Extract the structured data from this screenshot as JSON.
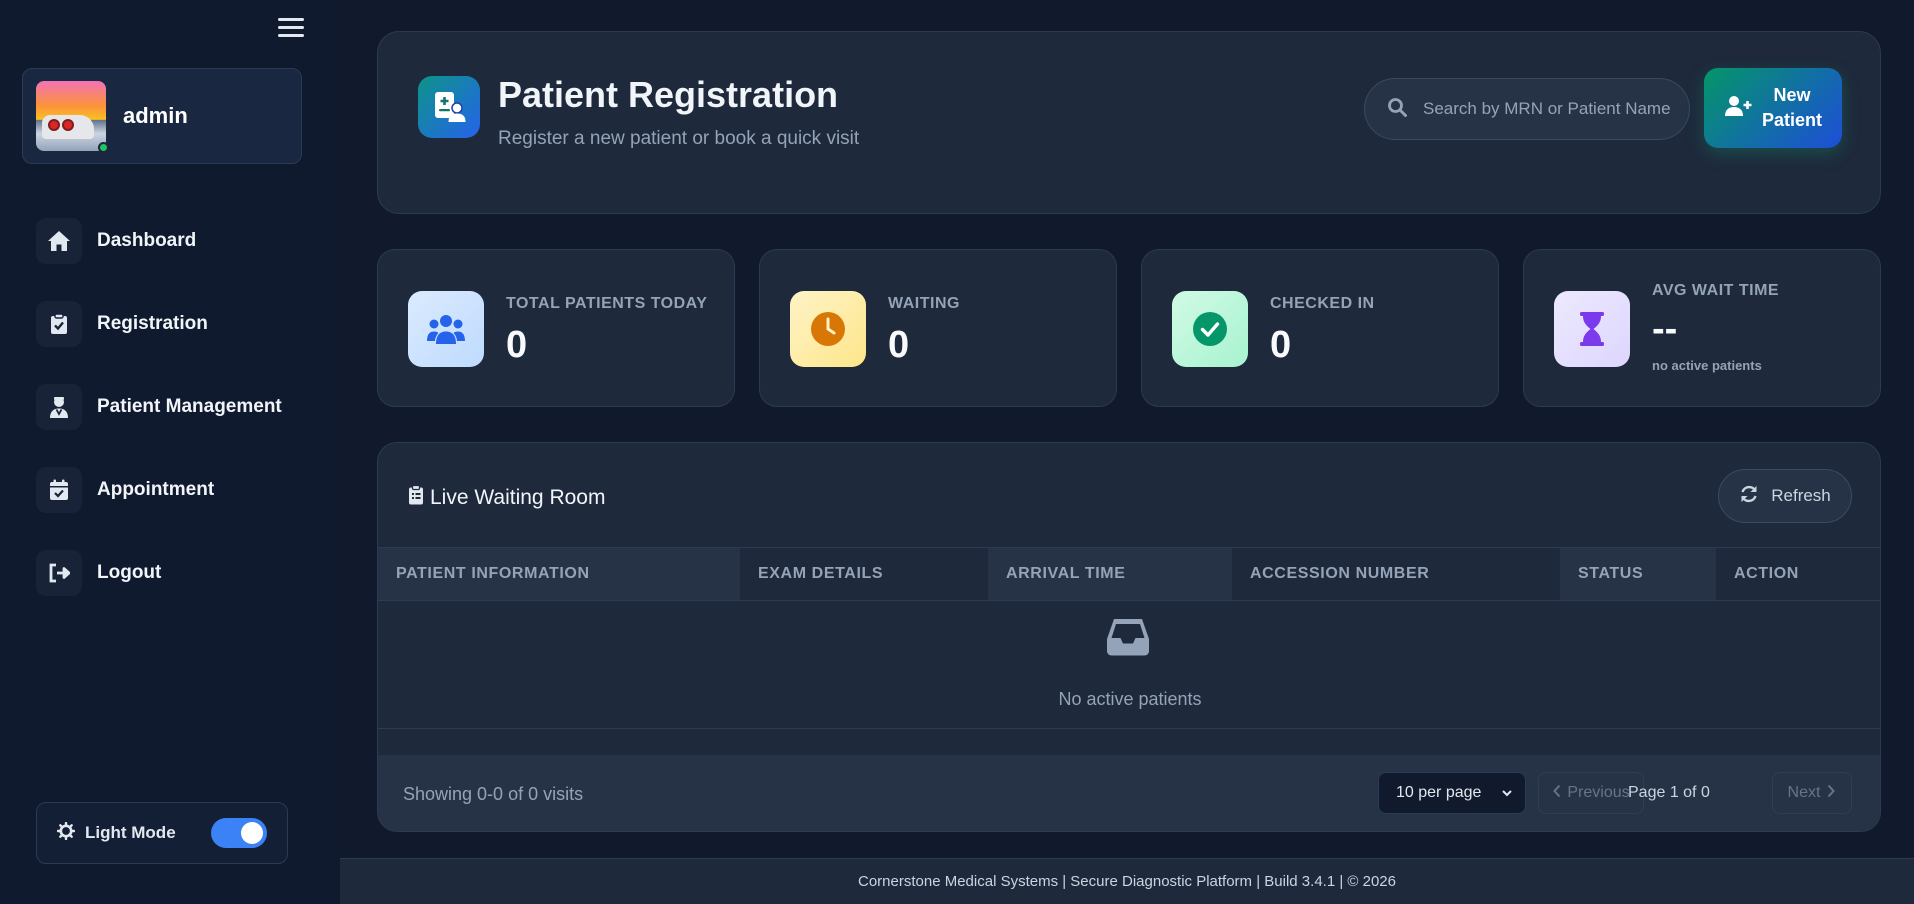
{
  "sidebar": {
    "user": {
      "name": "admin",
      "status": "online"
    },
    "items": [
      {
        "label": "Dashboard",
        "icon": "home-icon"
      },
      {
        "label": "Registration",
        "icon": "clipboard-check-icon"
      },
      {
        "label": "Patient Management",
        "icon": "user-doctor-icon"
      },
      {
        "label": "Appointment",
        "icon": "calendar-check-icon"
      },
      {
        "label": "Logout",
        "icon": "logout-icon"
      }
    ],
    "theme": {
      "label": "Light Mode",
      "enabled": true
    }
  },
  "header": {
    "title": "Patient Registration",
    "subtitle": "Register a new patient or book a quick visit",
    "search_placeholder": "Search by MRN or Patient Name",
    "new_button": "New Patient"
  },
  "stats": [
    {
      "label": "TOTAL PATIENTS TODAY",
      "value": "0",
      "icon": "users-icon",
      "color": "#2563eb"
    },
    {
      "label": "WAITING",
      "value": "0",
      "icon": "clock-icon",
      "color": "#d97706"
    },
    {
      "label": "CHECKED IN",
      "value": "0",
      "icon": "check-circle-icon",
      "color": "#059669"
    },
    {
      "label": "AVG WAIT TIME",
      "value": "--",
      "note": "no active patients",
      "icon": "hourglass-icon",
      "color": "#7c3aed"
    }
  ],
  "waiting_room": {
    "title": "Live Waiting Room",
    "refresh_label": "Refresh",
    "columns": [
      "PATIENT INFORMATION",
      "EXAM DETAILS",
      "ARRIVAL TIME",
      "ACCESSION NUMBER",
      "STATUS",
      "ACTION"
    ],
    "empty_text": "No active patients",
    "showing": "Showing 0-0 of 0 visits",
    "per_page": "10 per page",
    "previous": "Previous",
    "page_info": "Page 1 of 0",
    "next": "Next"
  },
  "footer": "Cornerstone Medical Systems | Secure Diagnostic Platform | Build 3.4.1 | © 2026"
}
